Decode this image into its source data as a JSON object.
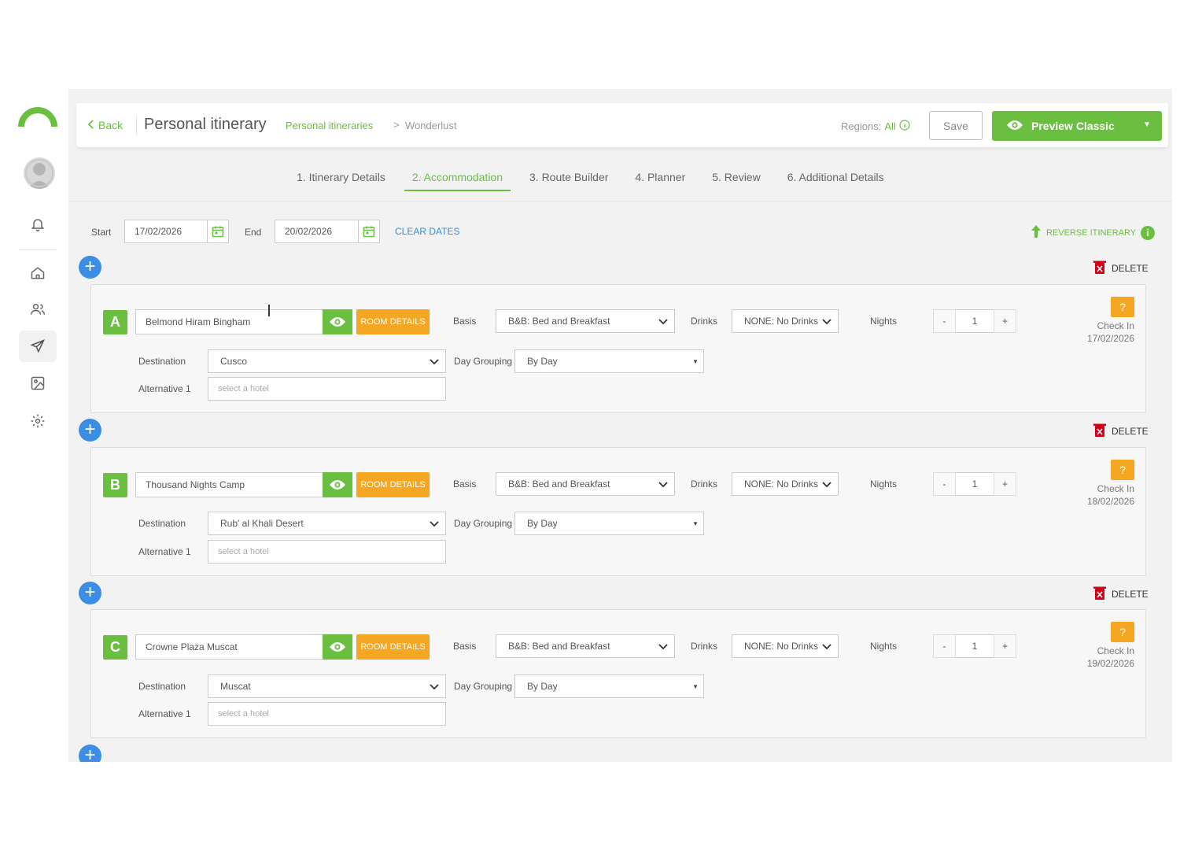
{
  "topbar": {
    "back_label": "Back",
    "title": "Personal itinerary",
    "breadcrumb_link": "Personal itineraries",
    "breadcrumb_separator": ">",
    "breadcrumb_current": "Wonderlust",
    "regions_label": "Regions:",
    "regions_value": "All",
    "save_label": "Save",
    "preview_label": "Preview Classic"
  },
  "tabs": [
    {
      "label": "1. Itinerary Details"
    },
    {
      "label": "2. Accommodation",
      "active": true
    },
    {
      "label": "3. Route Builder"
    },
    {
      "label": "4. Planner"
    },
    {
      "label": "5. Review"
    },
    {
      "label": "6. Additional Details"
    }
  ],
  "dates": {
    "start_label": "Start",
    "start_value": "17/02/2026",
    "end_label": "End",
    "end_value": "20/02/2026",
    "clear_label": "CLEAR DATES",
    "reverse_label": "REVERSE ITINERARY"
  },
  "labels": {
    "delete": "DELETE",
    "room_details": "ROOM DETAILS",
    "basis": "Basis",
    "drinks": "Drinks",
    "nights": "Nights",
    "destination": "Destination",
    "day_grouping": "Day Grouping",
    "alternative": "Alternative 1",
    "alt_placeholder": "select a hotel",
    "check_in": "Check In",
    "minus": "-",
    "plus": "+",
    "question": "?"
  },
  "stays": [
    {
      "letter": "A",
      "hotel": "Belmond Hiram Bingham",
      "basis": "B&B: Bed and Breakfast",
      "drinks": "NONE: No Drinks",
      "nights": "1",
      "destination": "Cusco",
      "day_grouping": "By Day",
      "check_in_date": "17/02/2026"
    },
    {
      "letter": "B",
      "hotel": "Thousand Nights Camp",
      "basis": "B&B: Bed and Breakfast",
      "drinks": "NONE: No Drinks",
      "nights": "1",
      "destination": "Rub' al Khali Desert",
      "day_grouping": "By Day",
      "check_in_date": "18/02/2026"
    },
    {
      "letter": "C",
      "hotel": "Crowne Plaza Muscat",
      "basis": "B&B: Bed and Breakfast",
      "drinks": "NONE: No Drinks",
      "nights": "1",
      "destination": "Muscat",
      "day_grouping": "By Day",
      "check_in_date": "19/02/2026"
    }
  ],
  "colors": {
    "brand_green": "#6abf40",
    "accent_orange": "#f5a623",
    "add_blue": "#3b8ee3",
    "link_blue": "#3b8ccf"
  },
  "icons": {
    "sidebar": [
      "bell-icon",
      "home-icon",
      "users-icon",
      "send-icon",
      "image-icon",
      "settings-icon"
    ]
  }
}
